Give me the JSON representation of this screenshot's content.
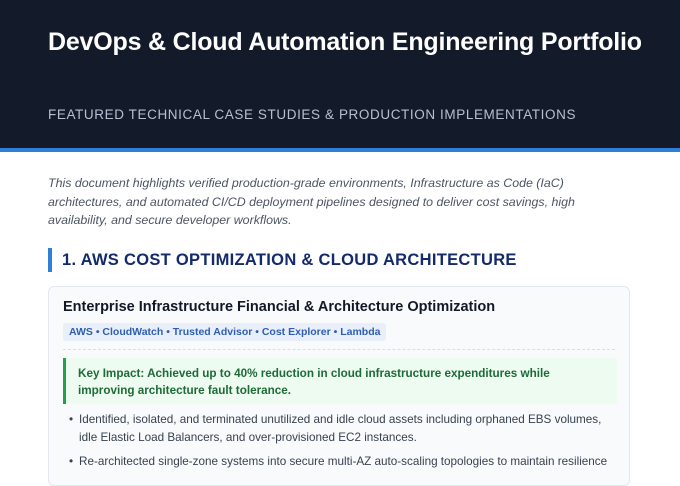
{
  "header": {
    "title": "DevOps & Cloud Automation Engineering Portfolio",
    "subtitle": "FEATURED TECHNICAL CASE STUDIES & PRODUCTION IMPLEMENTATIONS"
  },
  "intro": "This document highlights verified production-grade environments, Infrastructure as Code (IaC) architectures, and automated CI/CD deployment pipelines designed to deliver cost savings, high availability, and secure developer workflows.",
  "section": {
    "heading": "1. AWS COST OPTIMIZATION & CLOUD ARCHITECTURE",
    "card": {
      "title": "Enterprise Infrastructure Financial & Architecture Optimization",
      "tags": "AWS • CloudWatch • Trusted Advisor • Cost Explorer • Lambda",
      "impact": "Key Impact: Achieved up to 40% reduction in cloud infrastructure expenditures while improving architecture fault tolerance.",
      "bullet_symbol": "•",
      "bullets": [
        "Identified, isolated, and terminated unutilized and idle cloud assets including orphaned EBS volumes, idle Elastic Load Balancers, and over-provisioned EC2 instances.",
        "Re-architected single-zone systems into secure multi-AZ auto-scaling topologies to maintain resilience"
      ]
    }
  },
  "colors": {
    "header_bg": "#131a2a",
    "accent_blue": "#2f7ed8",
    "heading_navy": "#132a6b",
    "impact_green": "#1e6b37"
  }
}
